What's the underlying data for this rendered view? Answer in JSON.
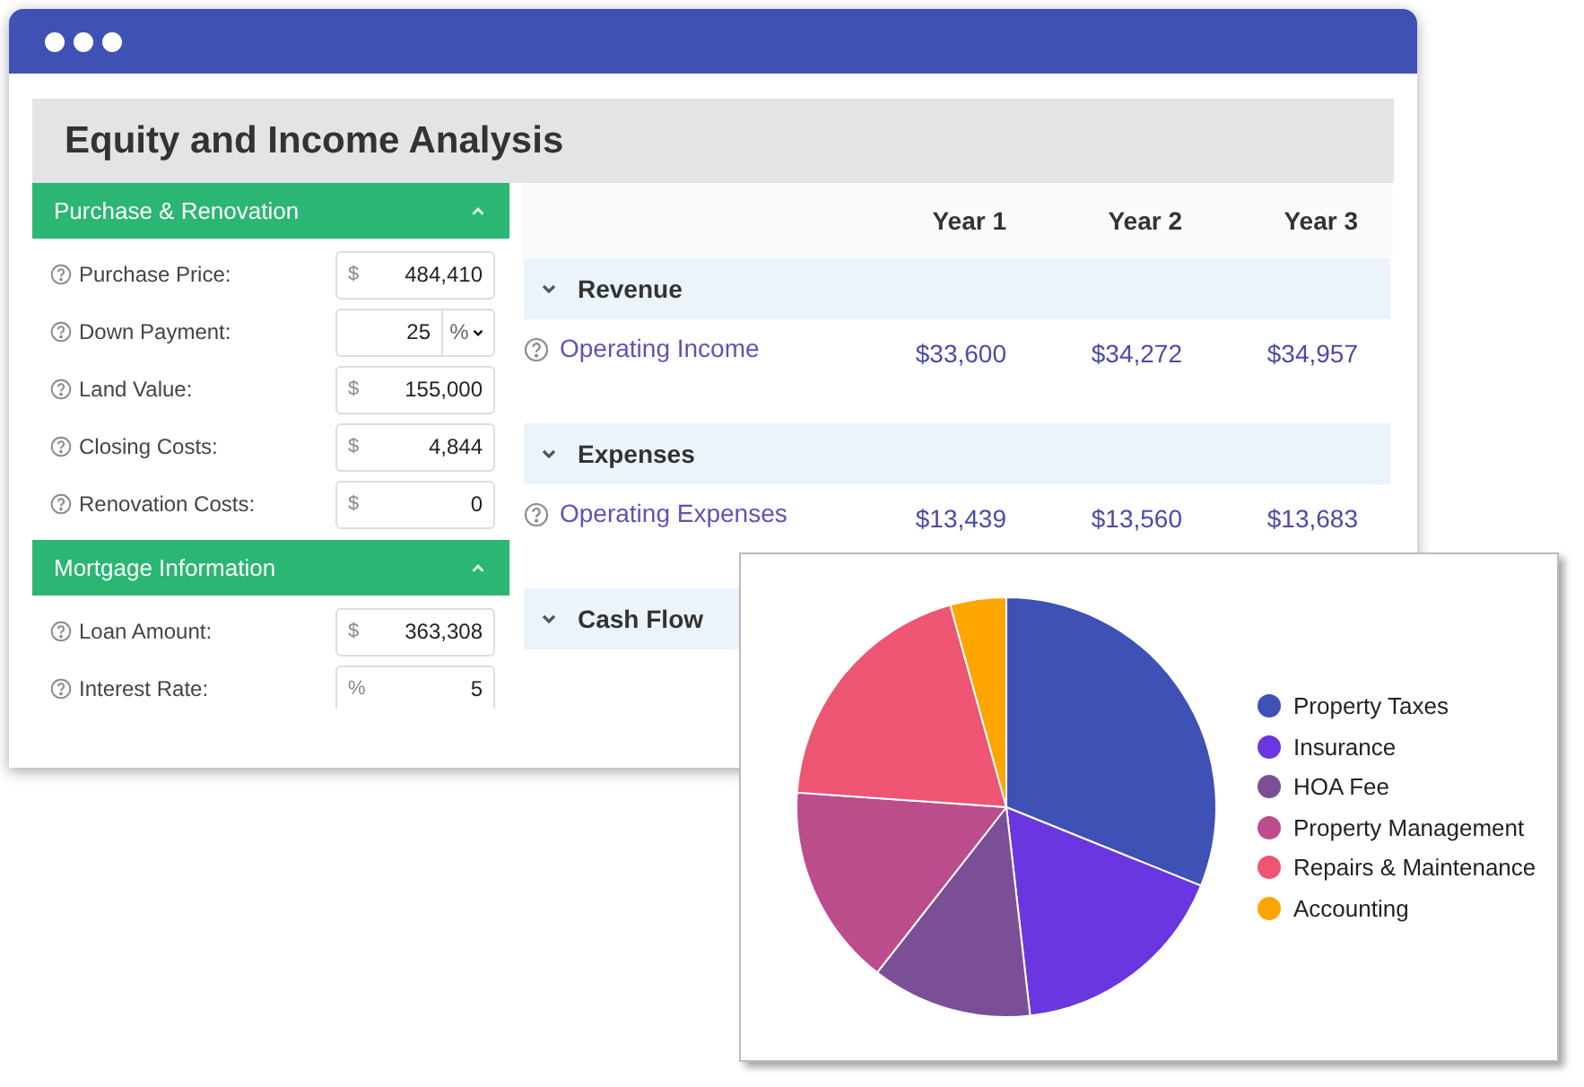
{
  "window": {
    "title": "Equity and Income Analysis"
  },
  "sections": [
    {
      "title": "Purchase & Renovation",
      "expanded": true,
      "fields": [
        {
          "label": "Purchase Price:",
          "kind": "prefix",
          "unit": "$",
          "value": "484,410"
        },
        {
          "label": "Down Payment:",
          "kind": "select",
          "unit": "%",
          "value": "25"
        },
        {
          "label": "Land Value:",
          "kind": "prefix",
          "unit": "$",
          "value": "155,000"
        },
        {
          "label": "Closing Costs:",
          "kind": "prefix",
          "unit": "$",
          "value": "4,844"
        },
        {
          "label": "Renovation Costs:",
          "kind": "prefix",
          "unit": "$",
          "value": "0"
        }
      ]
    },
    {
      "title": "Mortgage Information",
      "expanded": true,
      "fields": [
        {
          "label": "Loan Amount:",
          "kind": "prefix",
          "unit": "$",
          "value": "363,308"
        },
        {
          "label": "Interest Rate:",
          "kind": "prefix",
          "unit": "%",
          "value": "5"
        }
      ]
    }
  ],
  "table": {
    "columns": [
      "Year 1",
      "Year 2",
      "Year 3"
    ],
    "groups": [
      {
        "title": "Revenue",
        "expanded": true,
        "rows": [
          {
            "label": "Operating Income",
            "values": [
              "$33,600",
              "$34,272",
              "$34,957"
            ]
          }
        ]
      },
      {
        "title": "Expenses",
        "expanded": true,
        "rows": [
          {
            "label": "Operating Expenses",
            "values": [
              "$13,439",
              "$13,560",
              "$13,683"
            ]
          }
        ]
      },
      {
        "title": "Cash Flow",
        "expanded": true
      }
    ]
  },
  "chart": {
    "legend": [
      {
        "label": "Property Taxes",
        "color": "#3f51b5"
      },
      {
        "label": "Insurance",
        "color": "#6a36e0"
      },
      {
        "label": "HOA Fee",
        "color": "#7a4f96"
      },
      {
        "label": "Property Management",
        "color": "#bb4d8d"
      },
      {
        "label": "Repairs & Maintenance",
        "color": "#ee5572"
      },
      {
        "label": "Accounting",
        "color": "#ffa500"
      }
    ]
  }
}
